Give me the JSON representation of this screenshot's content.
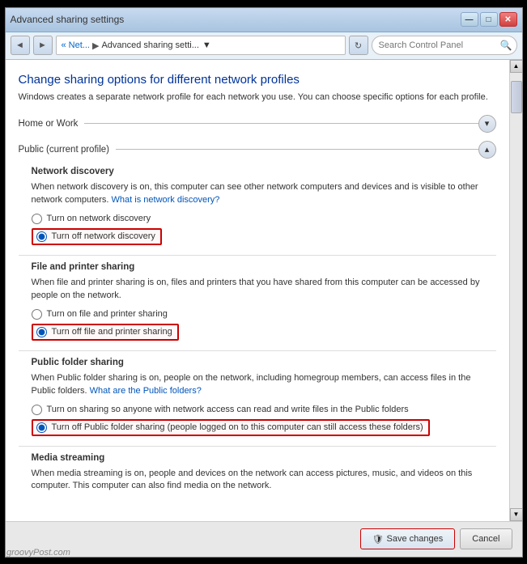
{
  "window": {
    "title": "Advanced sharing settings",
    "minimize_label": "—",
    "maximize_label": "□",
    "close_label": "✕"
  },
  "address_bar": {
    "back_label": "◄",
    "forward_label": "►",
    "breadcrumb_start": "« Net...",
    "breadcrumb_sep": "▶",
    "breadcrumb_current": "Advanced sharing setti...",
    "dropdown_label": "▼",
    "refresh_label": "↻",
    "search_placeholder": "Search Control Panel",
    "search_icon": "🔍"
  },
  "page": {
    "title": "Change sharing options for different network profiles",
    "subtitle": "Windows creates a separate network profile for each network you use. You can choose specific options for each profile.",
    "section_home": "Home or Work",
    "section_home_icon": "▾",
    "section_public": "Public (current profile)",
    "section_public_icon": "▴",
    "network_discovery": {
      "title": "Network discovery",
      "description": "When network discovery is on, this computer can see other network computers and devices and is visible to other network computers.",
      "link_text": "What is network discovery?",
      "option_on": "Turn on network discovery",
      "option_off": "Turn off network discovery",
      "selected": "off"
    },
    "file_printer": {
      "title": "File and printer sharing",
      "description": "When file and printer sharing is on, files and printers that you have shared from this computer can be accessed by people on the network.",
      "option_on": "Turn on file and printer sharing",
      "option_off": "Turn off file and printer sharing",
      "selected": "off"
    },
    "public_folder": {
      "title": "Public folder sharing",
      "description": "When Public folder sharing is on, people on the network, including homegroup members, can access files in the Public folders.",
      "link_text": "What are the Public folders?",
      "option_on": "Turn on sharing so anyone with network access can read and write files in the Public folders",
      "option_off": "Turn off Public folder sharing (people logged on to this computer can still access these folders)",
      "selected": "off"
    },
    "media_streaming": {
      "title": "Media streaming",
      "description": "When media streaming is on, people and devices on the network can access pictures, music, and videos on this computer. This computer can also find media on the network."
    }
  },
  "footer": {
    "save_label": "Save changes",
    "cancel_label": "Cancel",
    "save_icon": "🛡"
  },
  "watermark": "groovyPost.com"
}
